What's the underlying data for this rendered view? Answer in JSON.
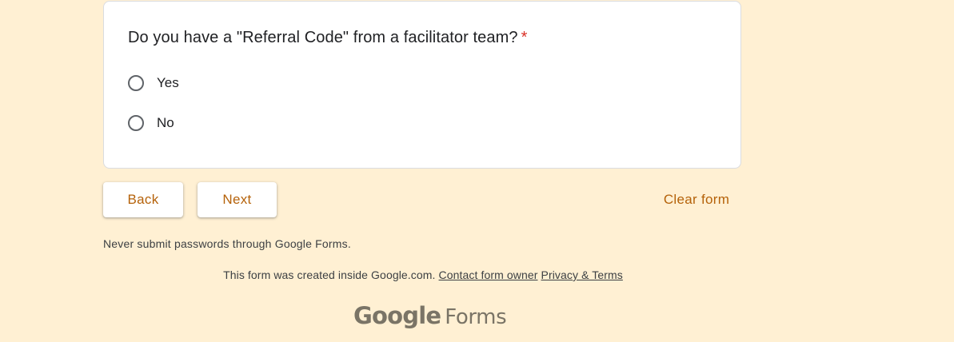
{
  "question": {
    "text": "Do you have a \"Referral Code\" from a facilitator team?",
    "required_marker": "*",
    "options": [
      {
        "label": "Yes",
        "selected": false
      },
      {
        "label": "No",
        "selected": false
      }
    ]
  },
  "navigation": {
    "back_label": "Back",
    "next_label": "Next",
    "clear_label": "Clear form"
  },
  "warning_text": "Never submit passwords through Google Forms.",
  "footer": {
    "created_text": "This form was created inside Google.com.",
    "contact_link": "Contact form owner",
    "privacy_link": "Privacy & Terms"
  },
  "brand": {
    "google": "Google",
    "forms": "Forms"
  },
  "colors": {
    "background": "#fff0d3",
    "accent": "#b5620a",
    "required": "#d93025"
  }
}
